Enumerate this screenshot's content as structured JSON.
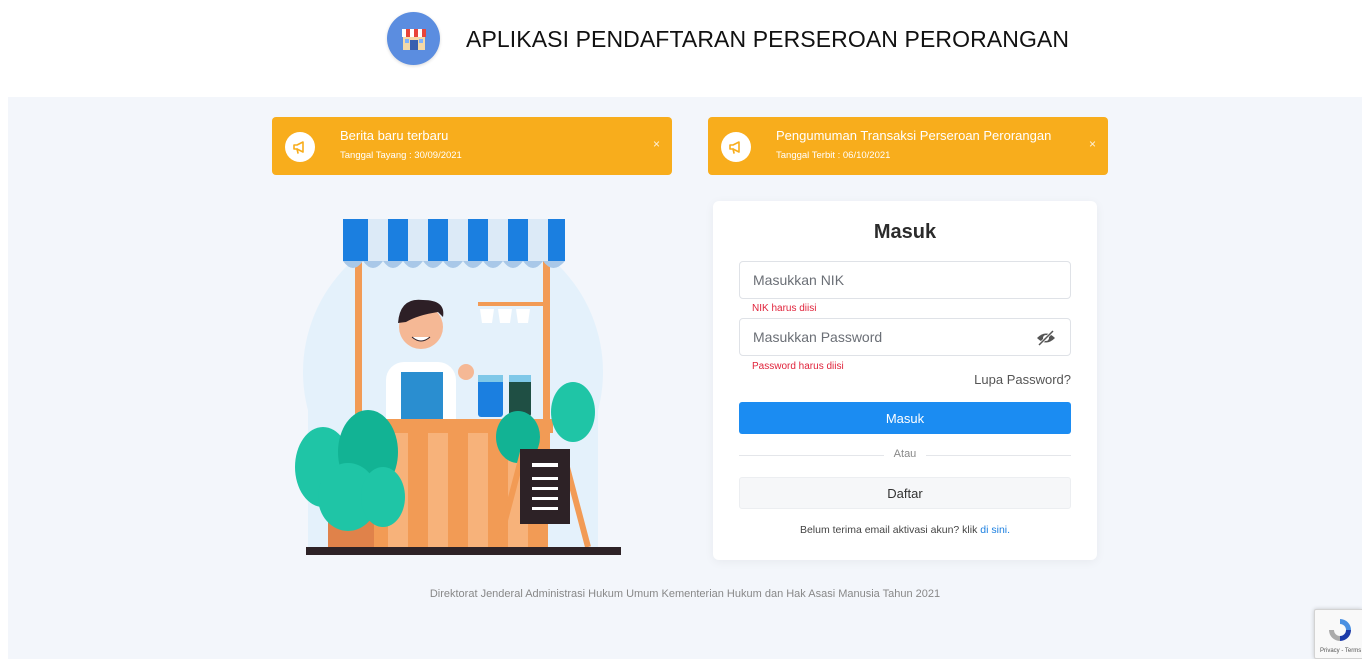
{
  "header": {
    "app_title": "APLIKASI PENDAFTARAN PERSEROAN PERORANGAN",
    "logo_icon": "shop-icon"
  },
  "notices": [
    {
      "title": "Berita baru terbaru",
      "date": "Tanggal Tayang : 30/09/2021",
      "close": "×",
      "icon": "megaphone-icon"
    },
    {
      "title": "Pengumuman Transaksi Perseroan Perorangan",
      "date": "Tanggal Terbit : 06/10/2021",
      "close": "×",
      "icon": "megaphone-icon"
    }
  ],
  "login": {
    "title": "Masuk",
    "nik_placeholder": "Masukkan NIK",
    "nik_value": "",
    "nik_error": "NIK harus diisi",
    "password_placeholder": "Masukkan Password",
    "password_value": "",
    "password_error": "Password harus diisi",
    "password_toggle_icon": "eye-slash-icon",
    "forgot_label": "Lupa Password?",
    "submit_label": "Masuk",
    "or_label": "Atau",
    "register_label": "Daftar",
    "activation_text": "Belum terima email aktivasi akun? klik",
    "activation_link": "di sini."
  },
  "footer": {
    "text": "Direktorat Jenderal Administrasi Hukum Umum Kementerian Hukum dan Hak Asasi Manusia Tahun 2021"
  },
  "recaptcha": {
    "label": "Privacy - Terms"
  },
  "colors": {
    "primary": "#1b8cf2",
    "notice": "#f8ad1c",
    "error": "#e0233b",
    "background": "#f3f6fb"
  }
}
